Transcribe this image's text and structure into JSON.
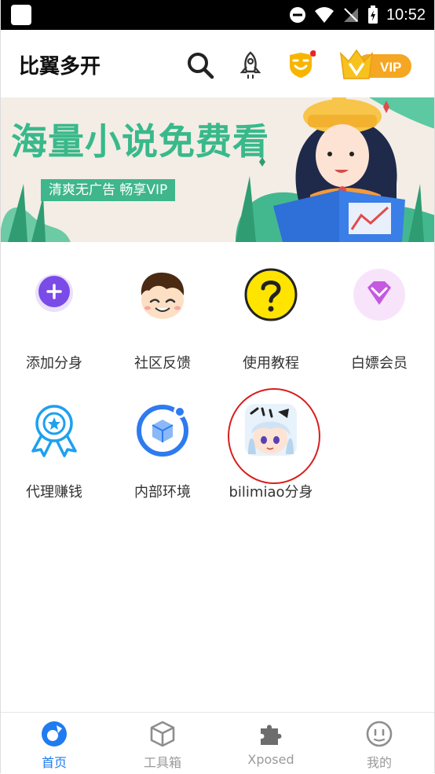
{
  "status_bar": {
    "time": "10:52"
  },
  "header": {
    "title": "比翼多开",
    "vip_label": "VIP",
    "icons": [
      "search-icon",
      "rocket-icon",
      "shield-notification-icon",
      "vip-crown-icon"
    ]
  },
  "banner": {
    "headline": "海量小说免费看",
    "subline": "清爽无广告 畅享VIP"
  },
  "grid": {
    "items": [
      {
        "label": "添加分身",
        "icon": "add-clone-icon"
      },
      {
        "label": "社区反馈",
        "icon": "community-face-icon"
      },
      {
        "label": "使用教程",
        "icon": "tutorial-question-icon"
      },
      {
        "label": "白嫖会员",
        "icon": "free-vip-diamond-icon"
      },
      {
        "label": "代理赚钱",
        "icon": "agent-ribbon-icon"
      },
      {
        "label": "内部环境",
        "icon": "internal-env-box-icon"
      },
      {
        "label": "bilimiao分身",
        "icon": "bilimiao-app-icon"
      }
    ]
  },
  "tabbar": {
    "tabs": [
      {
        "label": "首页",
        "active": true,
        "icon": "home-icon"
      },
      {
        "label": "工具箱",
        "active": false,
        "icon": "toolbox-cube-icon"
      },
      {
        "label": "Xposed",
        "active": false,
        "icon": "puzzle-icon"
      },
      {
        "label": "我的",
        "active": false,
        "icon": "profile-face-icon"
      }
    ]
  },
  "colors": {
    "accent_blue": "#1f7cf0",
    "banner_green": "#39b98b",
    "vip_gold": "#f5a623",
    "annotation_red": "#d81e1e"
  }
}
